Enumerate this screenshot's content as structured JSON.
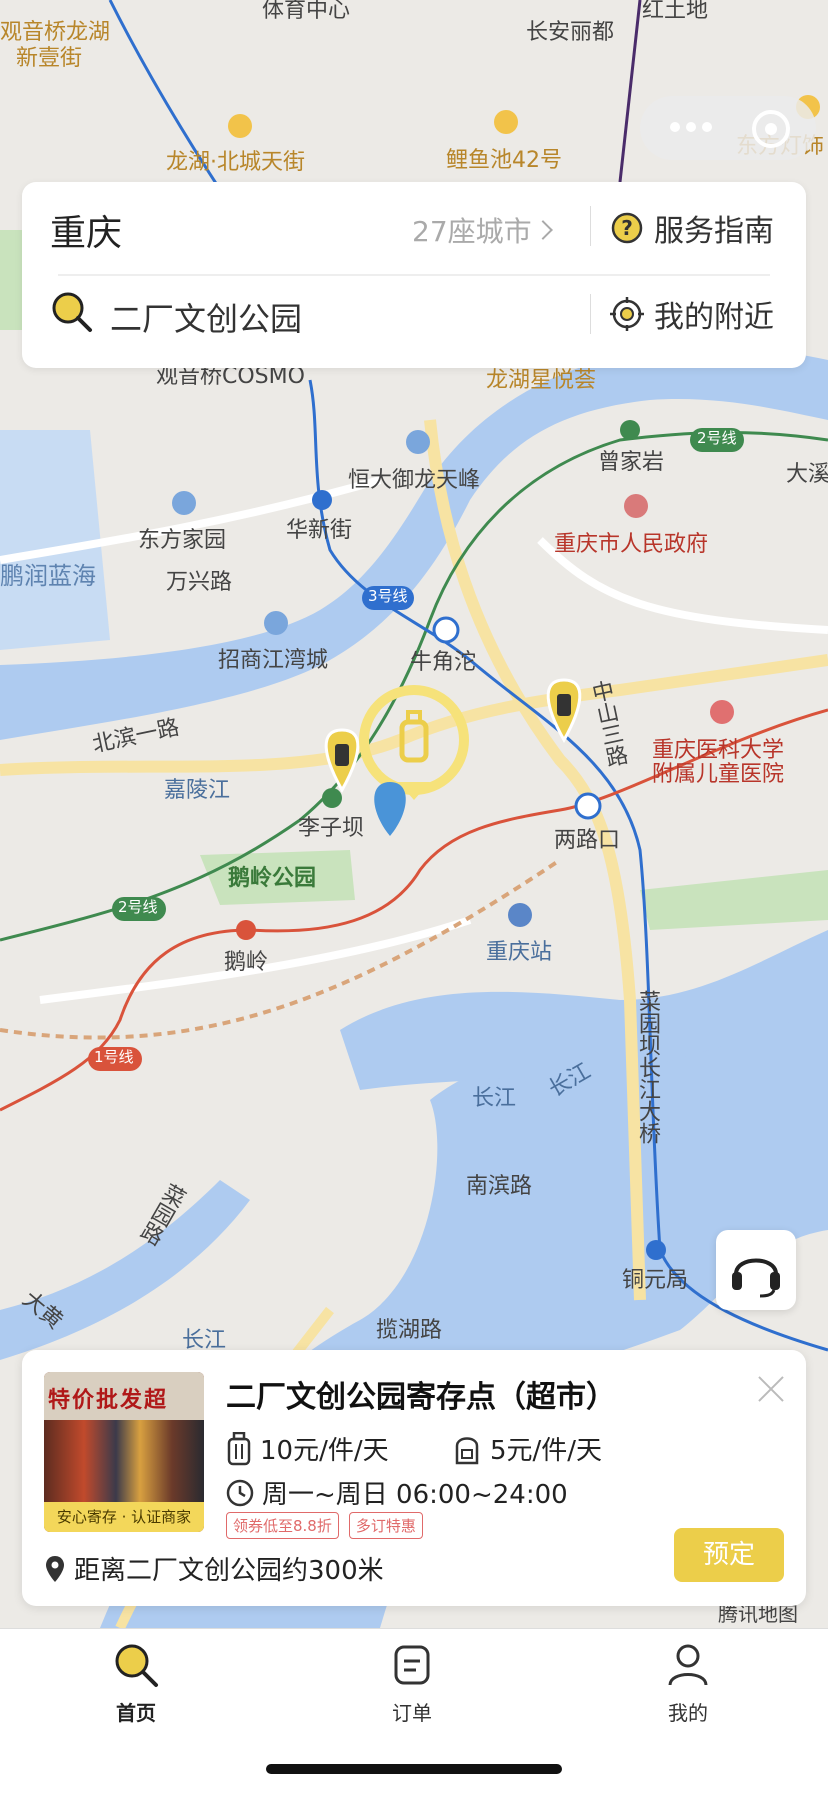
{
  "map": {
    "labels": {
      "sports_center": "体育中心",
      "changan_lidu": "长安丽都",
      "guanyinqiao_longhu": "观音桥龙湖",
      "xinyijie": "新壹街",
      "honglu": "红土地",
      "longhu_beicheng": "龙湖·北城天街",
      "liyuchi": "鲤鱼池42号",
      "dongfang_light": "东方灯饰",
      "guanyinqiao_cosmo": "观音桥COSMO",
      "longhu_xingyue": "龙湖星悦荟",
      "hengda": "恒大御龙天峰",
      "zengjiayan": "曾家岩",
      "daxi": "大溪",
      "dongfang_jiayuan": "东方家园",
      "huaxinjie": "华新街",
      "gov": "重庆市人民政府",
      "pengrun": "鹏润蓝海",
      "wanxing_road": "万兴路",
      "line3": "3号线",
      "line2_top": "2号线",
      "zhaoshang": "招商江湾城",
      "niujiaotuo": "牛角沱",
      "zhongshan_road": "中山三路",
      "medical": "重庆医科大学",
      "medical2": "附属儿童医院",
      "beibin_road": "北滨一路",
      "jialing_river": "嘉陵江",
      "liziba": "李子坝",
      "lianglukou": "两路口",
      "eling_park": "鹅岭公园",
      "line2_bottom": "2号线",
      "eling": "鹅岭",
      "chongqing_station": "重庆站",
      "line1": "1号线",
      "caiyuanba_bridge": "菜园坝长江大桥",
      "changjiang1": "长江",
      "changjiang2": "长江",
      "nanbin_road": "南滨路",
      "caiyuan_road": "菜园路",
      "tongyuanju": "铜元局",
      "lanhu_road": "揽湖路",
      "changjiang3": "长江",
      "dahuang": "大黄",
      "tencent_map": "腾讯地图"
    }
  },
  "search": {
    "city": "重庆",
    "city_count": "27座城市",
    "guide_label": "服务指南",
    "keyword": "二厂文创公园",
    "nearby_label": "我的附近"
  },
  "store": {
    "sign_text": "特价批发超",
    "badge": "安心寄存 · 认证商家",
    "title": "二厂文创公园寄存点（超市）",
    "price_luggage": "10元/件/天",
    "price_bag": "5元/件/天",
    "hours": "周一~周日 06:00~24:00",
    "tags": [
      "领券低至8.8折",
      "多订特惠"
    ],
    "distance": "距离二厂文创公园约300米",
    "book_label": "预定"
  },
  "tabs": [
    {
      "label": "首页",
      "icon": "search-icon",
      "active": true
    },
    {
      "label": "订单",
      "icon": "order-icon",
      "active": false
    },
    {
      "label": "我的",
      "icon": "profile-icon",
      "active": false
    }
  ],
  "colors": {
    "accent": "#ecce4a",
    "metro_line1": "#d9533b",
    "metro_line2": "#3f8a4f",
    "metro_line3": "#2f6fce",
    "water": "#aecbf0",
    "park": "#c9e3bd"
  }
}
